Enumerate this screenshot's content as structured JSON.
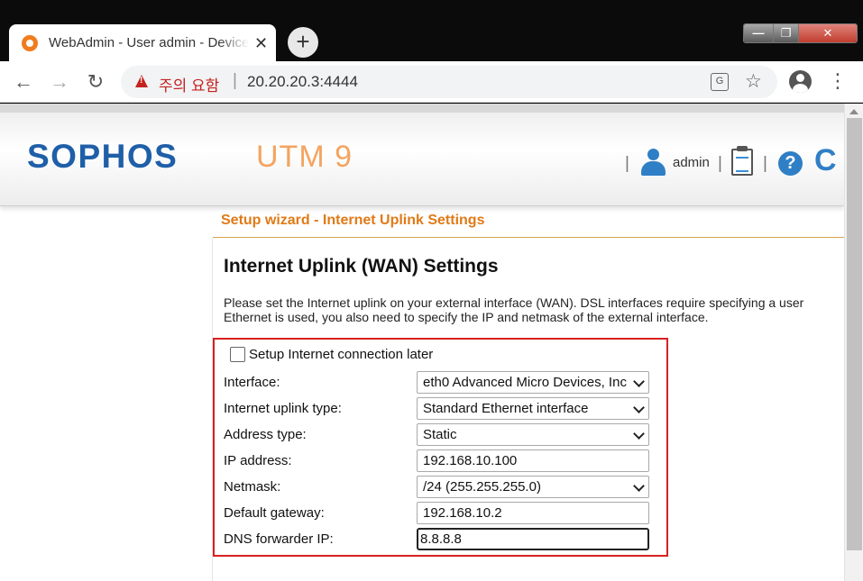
{
  "browser": {
    "tab_title": "WebAdmin - User admin - Device",
    "tab_close": "✕",
    "new_tab": "+",
    "security_label": "주의 요함",
    "separator": "|",
    "url": "20.20.20.3:4444",
    "translate_glyph": "G",
    "bookmark_glyph": "☆",
    "back_glyph": "←",
    "forward_glyph": "→",
    "reload_glyph": "↻",
    "menu_glyph": "⋮",
    "window_min": "—",
    "window_max": "❐",
    "window_close": "✕"
  },
  "header": {
    "brand": "SOPHOS",
    "product": "UTM 9",
    "separator": "|",
    "user": "admin",
    "help_glyph": "?",
    "refresh_glyph": "C"
  },
  "page": {
    "wizard_title": "Setup wizard - Internet Uplink Settings",
    "heading": "Internet Uplink (WAN) Settings",
    "description_line1": "Please set the Internet uplink on your external interface (WAN). DSL interfaces require specifying a user",
    "description_line2": "Ethernet is used, you also need to specify the IP and netmask of the external interface."
  },
  "form": {
    "setup_later_label": "Setup Internet connection later",
    "setup_later_checked": false,
    "fields": [
      {
        "label": "Interface:",
        "value": "eth0 Advanced Micro Devices, Inc",
        "type": "select"
      },
      {
        "label": "Internet uplink type:",
        "value": "Standard Ethernet interface",
        "type": "select"
      },
      {
        "label": "Address type:",
        "value": "Static",
        "type": "select"
      },
      {
        "label": "IP address:",
        "value": "192.168.10.100",
        "type": "text"
      },
      {
        "label": "Netmask:",
        "value": "/24 (255.255.255.0)",
        "type": "select"
      },
      {
        "label": "Default gateway:",
        "value": "192.168.10.2",
        "type": "text"
      },
      {
        "label": "DNS forwarder IP:",
        "value": "8.8.8.8",
        "type": "text",
        "focused": true
      }
    ]
  },
  "colors": {
    "brand_blue": "#1f5fa8",
    "product_orange": "#f4a460",
    "wizard_orange": "#e07a17",
    "highlight_red": "#d92020",
    "icon_blue": "#2f7fc6"
  }
}
